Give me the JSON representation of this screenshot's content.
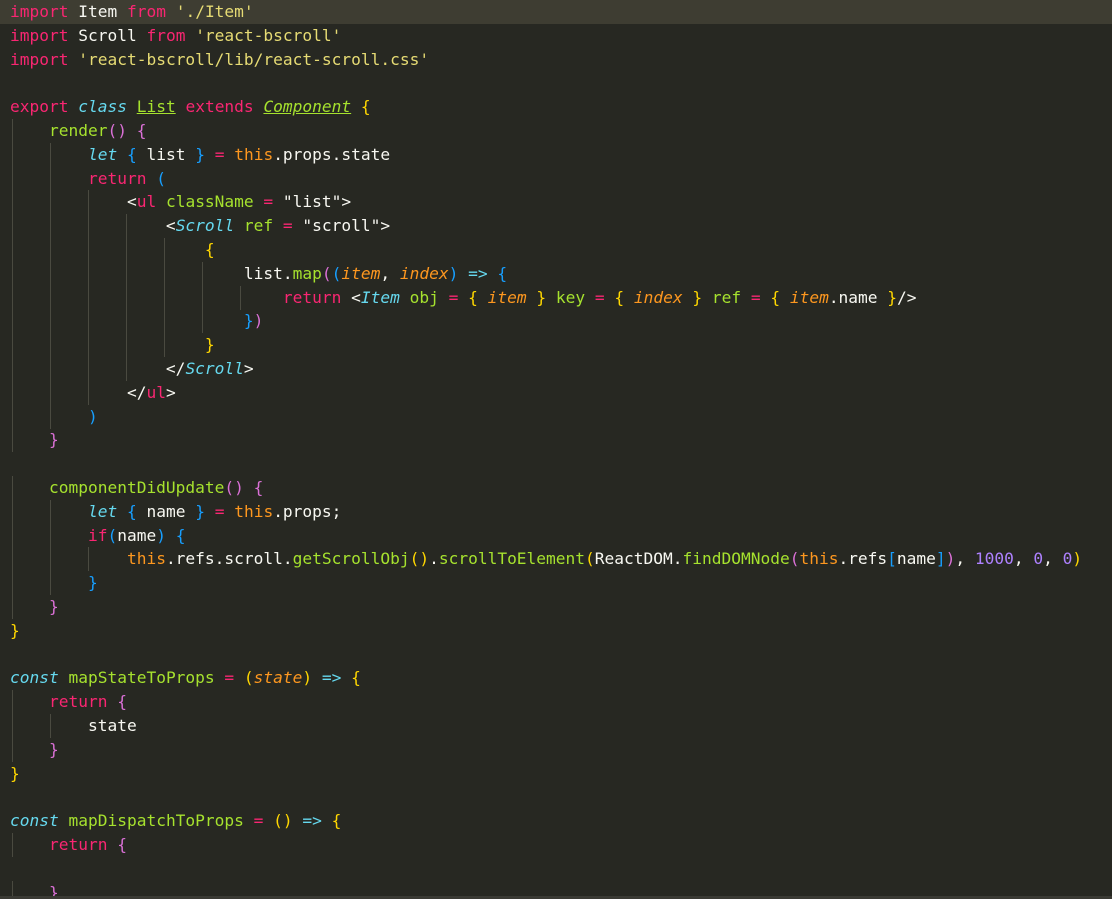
{
  "editor": {
    "lines": [
      [
        [
          "kw",
          "import"
        ],
        [
          "txt",
          " Item "
        ],
        [
          "kw",
          "from"
        ],
        [
          "txt",
          " "
        ],
        [
          "str",
          "'./Item'"
        ]
      ],
      [
        [
          "kw",
          "import"
        ],
        [
          "txt",
          " Scroll "
        ],
        [
          "kw",
          "from"
        ],
        [
          "txt",
          " "
        ],
        [
          "str",
          "'react-bscroll'"
        ]
      ],
      [
        [
          "kw",
          "import"
        ],
        [
          "txt",
          " "
        ],
        [
          "str",
          "'react-bscroll/lib/react-scroll.css'"
        ]
      ],
      [],
      [
        [
          "kw",
          "export"
        ],
        [
          "txt",
          " "
        ],
        [
          "st",
          "class"
        ],
        [
          "txt",
          " "
        ],
        [
          "cls",
          "List"
        ],
        [
          "txt",
          " "
        ],
        [
          "kw",
          "extends"
        ],
        [
          "txt",
          " "
        ],
        [
          "inh",
          "Component"
        ],
        [
          "txt",
          " "
        ],
        [
          "b1",
          "{"
        ]
      ],
      [
        [
          "txt",
          "    "
        ],
        [
          "fn",
          "render"
        ],
        [
          "b2",
          "()"
        ],
        [
          "txt",
          " "
        ],
        [
          "b2",
          "{"
        ]
      ],
      [
        [
          "txt",
          "        "
        ],
        [
          "st",
          "let"
        ],
        [
          "txt",
          " "
        ],
        [
          "b3",
          "{"
        ],
        [
          "txt",
          " list "
        ],
        [
          "b3",
          "}"
        ],
        [
          "txt",
          " "
        ],
        [
          "op",
          "="
        ],
        [
          "txt",
          " "
        ],
        [
          "this",
          "this"
        ],
        [
          "txt",
          ".props.state"
        ]
      ],
      [
        [
          "txt",
          "        "
        ],
        [
          "kw",
          "return"
        ],
        [
          "txt",
          " "
        ],
        [
          "b3",
          "("
        ]
      ],
      [
        [
          "txt",
          "            <"
        ],
        [
          "tag",
          "ul"
        ],
        [
          "txt",
          " "
        ],
        [
          "att",
          "className"
        ],
        [
          "txt",
          " "
        ],
        [
          "op",
          "="
        ],
        [
          "txt",
          " \"list\">"
        ]
      ],
      [
        [
          "txt",
          "                <"
        ],
        [
          "cmp",
          "Scroll"
        ],
        [
          "txt",
          " "
        ],
        [
          "att",
          "ref"
        ],
        [
          "txt",
          " "
        ],
        [
          "op",
          "="
        ],
        [
          "txt",
          " \"scroll\">"
        ]
      ],
      [
        [
          "txt",
          "                    "
        ],
        [
          "b1",
          "{"
        ]
      ],
      [
        [
          "txt",
          "                        list."
        ],
        [
          "fn",
          "map"
        ],
        [
          "b2",
          "("
        ],
        [
          "b3",
          "("
        ],
        [
          "prm",
          "item"
        ],
        [
          "txt",
          ", "
        ],
        [
          "prm",
          "index"
        ],
        [
          "b3",
          ")"
        ],
        [
          "txt",
          " "
        ],
        [
          "st",
          "=>"
        ],
        [
          "txt",
          " "
        ],
        [
          "b3",
          "{"
        ]
      ],
      [
        [
          "txt",
          "                            "
        ],
        [
          "kw",
          "return"
        ],
        [
          "txt",
          " <"
        ],
        [
          "cmp",
          "Item"
        ],
        [
          "txt",
          " "
        ],
        [
          "att",
          "obj"
        ],
        [
          "txt",
          " "
        ],
        [
          "op",
          "="
        ],
        [
          "txt",
          " "
        ],
        [
          "b1",
          "{"
        ],
        [
          "txt",
          " "
        ],
        [
          "prm",
          "item"
        ],
        [
          "txt",
          " "
        ],
        [
          "b1",
          "}"
        ],
        [
          "txt",
          " "
        ],
        [
          "att",
          "key"
        ],
        [
          "txt",
          " "
        ],
        [
          "op",
          "="
        ],
        [
          "txt",
          " "
        ],
        [
          "b1",
          "{"
        ],
        [
          "txt",
          " "
        ],
        [
          "prm",
          "index"
        ],
        [
          "txt",
          " "
        ],
        [
          "b1",
          "}"
        ],
        [
          "txt",
          " "
        ],
        [
          "att",
          "ref"
        ],
        [
          "txt",
          " "
        ],
        [
          "op",
          "="
        ],
        [
          "txt",
          " "
        ],
        [
          "b1",
          "{"
        ],
        [
          "txt",
          " "
        ],
        [
          "prm",
          "item"
        ],
        [
          "txt",
          ".name "
        ],
        [
          "b1",
          "}"
        ],
        [
          "txt",
          "/>"
        ]
      ],
      [
        [
          "txt",
          "                        "
        ],
        [
          "b3",
          "}"
        ],
        [
          "b2",
          ")"
        ]
      ],
      [
        [
          "txt",
          "                    "
        ],
        [
          "b1",
          "}"
        ]
      ],
      [
        [
          "txt",
          "                </"
        ],
        [
          "cmp",
          "Scroll"
        ],
        [
          "txt",
          ">"
        ]
      ],
      [
        [
          "txt",
          "            </"
        ],
        [
          "tag",
          "ul"
        ],
        [
          "txt",
          ">"
        ]
      ],
      [
        [
          "txt",
          "        "
        ],
        [
          "b3",
          ")"
        ]
      ],
      [
        [
          "txt",
          "    "
        ],
        [
          "b2",
          "}"
        ]
      ],
      [],
      [
        [
          "txt",
          "    "
        ],
        [
          "fn",
          "componentDidUpdate"
        ],
        [
          "b2",
          "()"
        ],
        [
          "txt",
          " "
        ],
        [
          "b2",
          "{"
        ]
      ],
      [
        [
          "txt",
          "        "
        ],
        [
          "st",
          "let"
        ],
        [
          "txt",
          " "
        ],
        [
          "b3",
          "{"
        ],
        [
          "txt",
          " name "
        ],
        [
          "b3",
          "}"
        ],
        [
          "txt",
          " "
        ],
        [
          "op",
          "="
        ],
        [
          "txt",
          " "
        ],
        [
          "this",
          "this"
        ],
        [
          "txt",
          ".props;"
        ]
      ],
      [
        [
          "txt",
          "        "
        ],
        [
          "kw",
          "if"
        ],
        [
          "b3",
          "("
        ],
        [
          "txt",
          "name"
        ],
        [
          "b3",
          ")"
        ],
        [
          "txt",
          " "
        ],
        [
          "b3",
          "{"
        ]
      ],
      [
        [
          "txt",
          "            "
        ],
        [
          "this",
          "this"
        ],
        [
          "txt",
          ".refs.scroll."
        ],
        [
          "fn",
          "getScrollObj"
        ],
        [
          "b1",
          "()"
        ],
        [
          "txt",
          "."
        ],
        [
          "fn",
          "scrollToElement"
        ],
        [
          "b1",
          "("
        ],
        [
          "txt",
          "ReactDOM."
        ],
        [
          "fn",
          "findDOMNode"
        ],
        [
          "b2",
          "("
        ],
        [
          "this",
          "this"
        ],
        [
          "txt",
          ".refs"
        ],
        [
          "b3",
          "["
        ],
        [
          "txt",
          "name"
        ],
        [
          "b3",
          "]"
        ],
        [
          "b2",
          ")"
        ],
        [
          "txt",
          ", "
        ],
        [
          "num",
          "1000"
        ],
        [
          "txt",
          ", "
        ],
        [
          "num",
          "0"
        ],
        [
          "txt",
          ", "
        ],
        [
          "num",
          "0"
        ],
        [
          "b1",
          ")"
        ]
      ],
      [
        [
          "txt",
          "        "
        ],
        [
          "b3",
          "}"
        ]
      ],
      [
        [
          "txt",
          "    "
        ],
        [
          "b2",
          "}"
        ]
      ],
      [
        [
          "b1",
          "}"
        ]
      ],
      [],
      [
        [
          "st",
          "const"
        ],
        [
          "txt",
          " "
        ],
        [
          "fn",
          "mapStateToProps"
        ],
        [
          "txt",
          " "
        ],
        [
          "op",
          "="
        ],
        [
          "txt",
          " "
        ],
        [
          "b1",
          "("
        ],
        [
          "prm",
          "state"
        ],
        [
          "b1",
          ")"
        ],
        [
          "txt",
          " "
        ],
        [
          "st",
          "=>"
        ],
        [
          "txt",
          " "
        ],
        [
          "b1",
          "{"
        ]
      ],
      [
        [
          "txt",
          "    "
        ],
        [
          "kw",
          "return"
        ],
        [
          "txt",
          " "
        ],
        [
          "b2",
          "{"
        ]
      ],
      [
        [
          "txt",
          "        state"
        ]
      ],
      [
        [
          "txt",
          "    "
        ],
        [
          "b2",
          "}"
        ]
      ],
      [
        [
          "b1",
          "}"
        ]
      ],
      [],
      [
        [
          "st",
          "const"
        ],
        [
          "txt",
          " "
        ],
        [
          "fn",
          "mapDispatchToProps"
        ],
        [
          "txt",
          " "
        ],
        [
          "op",
          "="
        ],
        [
          "txt",
          " "
        ],
        [
          "b1",
          "()"
        ],
        [
          "txt",
          " "
        ],
        [
          "st",
          "=>"
        ],
        [
          "txt",
          " "
        ],
        [
          "b1",
          "{"
        ]
      ],
      [
        [
          "txt",
          "    "
        ],
        [
          "kw",
          "return"
        ],
        [
          "txt",
          " "
        ],
        [
          "b2",
          "{"
        ]
      ],
      [],
      [
        [
          "txt",
          "    "
        ],
        [
          "b2",
          "}"
        ]
      ]
    ]
  }
}
